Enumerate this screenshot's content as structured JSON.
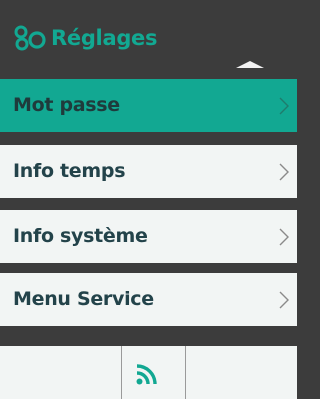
{
  "header": {
    "title": "Réglages",
    "icon": "settings-gear-pair-icon",
    "accent_color": "#12a892"
  },
  "menu": {
    "items": [
      {
        "label": "Mot passe",
        "selected": true
      },
      {
        "label": "Info temps",
        "selected": false
      },
      {
        "label": "Info système",
        "selected": false
      },
      {
        "label": "Menu Service",
        "selected": false
      }
    ],
    "chevron_icon": "chevron-right-icon"
  },
  "footer": {
    "icon": "rss-feed-icon",
    "icon_color": "#12a892"
  }
}
